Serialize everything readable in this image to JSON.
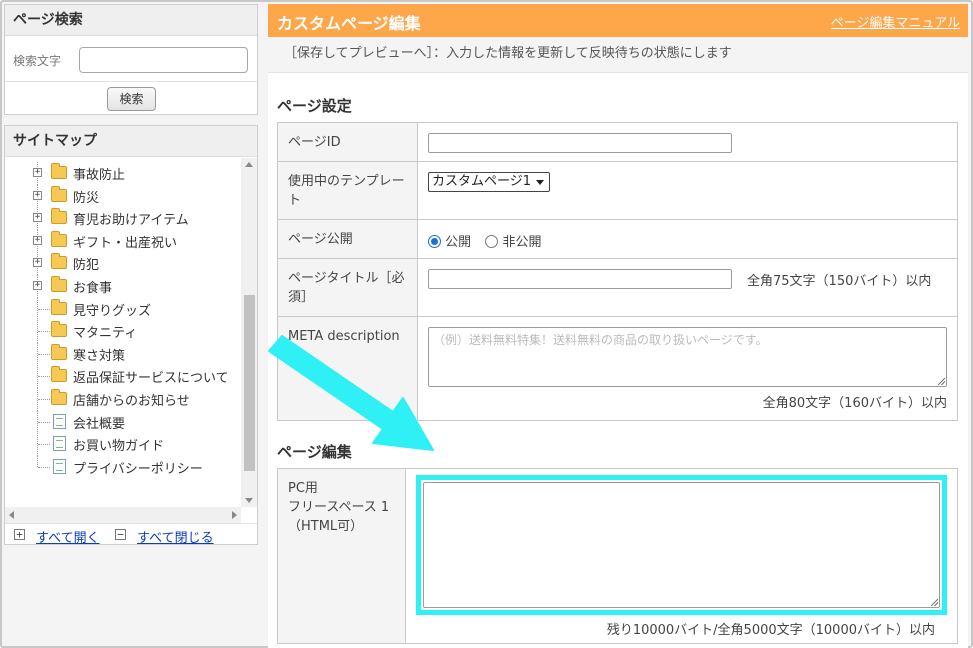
{
  "left": {
    "search_panel": {
      "title": "ページ検索",
      "label": "検索文字",
      "input_value": "",
      "button": "検索"
    },
    "sitemap": {
      "title": "サイトマップ",
      "items": [
        {
          "label": "事故防止",
          "type": "folder",
          "expandable": true
        },
        {
          "label": "防災",
          "type": "folder",
          "expandable": true
        },
        {
          "label": "育児お助けアイテム",
          "type": "folder",
          "expandable": true
        },
        {
          "label": "ギフト・出産祝い",
          "type": "folder",
          "expandable": true
        },
        {
          "label": "防犯",
          "type": "folder",
          "expandable": true
        },
        {
          "label": "お食事",
          "type": "folder",
          "expandable": true
        },
        {
          "label": "見守りグッズ",
          "type": "folder",
          "expandable": false
        },
        {
          "label": "マタニティ",
          "type": "folder",
          "expandable": false
        },
        {
          "label": "寒さ対策",
          "type": "folder",
          "expandable": false
        },
        {
          "label": "返品保証サービスについて",
          "type": "folder",
          "expandable": false
        },
        {
          "label": "店舗からのお知らせ",
          "type": "folder",
          "expandable": false
        },
        {
          "label": "会社概要",
          "type": "page",
          "expandable": false
        },
        {
          "label": "お買い物ガイド",
          "type": "page",
          "expandable": false
        },
        {
          "label": "プライバシーポリシー",
          "type": "page",
          "expandable": false
        }
      ],
      "expand_all": "すべて開く",
      "collapse_all": "すべて閉じる"
    }
  },
  "main": {
    "title": "カスタムページ編集",
    "manual_link": "ページ編集マニュアル",
    "notice": "［保存してプレビューへ］：入力した情報を更新して反映待ちの状態にします",
    "settings": {
      "title": "ページ設定",
      "page_id_label": "ページID",
      "page_id_value": "",
      "template_label": "使用中のテンプレート",
      "template_value": "カスタムページ1",
      "publish_label": "ページ公開",
      "publish_on": "公開",
      "publish_off": "非公開",
      "publish_selected": "公開",
      "page_title_label": "ページタイトル［必須］",
      "page_title_value": "",
      "page_title_hint": "全角75文字（150バイト）以内",
      "meta_label": "META description",
      "meta_placeholder": "（例）送料無料特集！送料無料の商品の取り扱いページです。",
      "meta_hint": "全角80文字（160バイト）以内"
    },
    "edit": {
      "title": "ページ編集",
      "pc_label_1": "PC用",
      "pc_label_2": "フリースペース 1",
      "pc_label_3": "（HTML可）",
      "pc_value": "",
      "pc_hint": "残り10000バイト/全角5000文字（10000バイト）以内"
    }
  },
  "colors": {
    "header_orange": "#fea64a",
    "highlight_cyan": "#2ff0f4",
    "link_blue": "#0b3cc1"
  }
}
